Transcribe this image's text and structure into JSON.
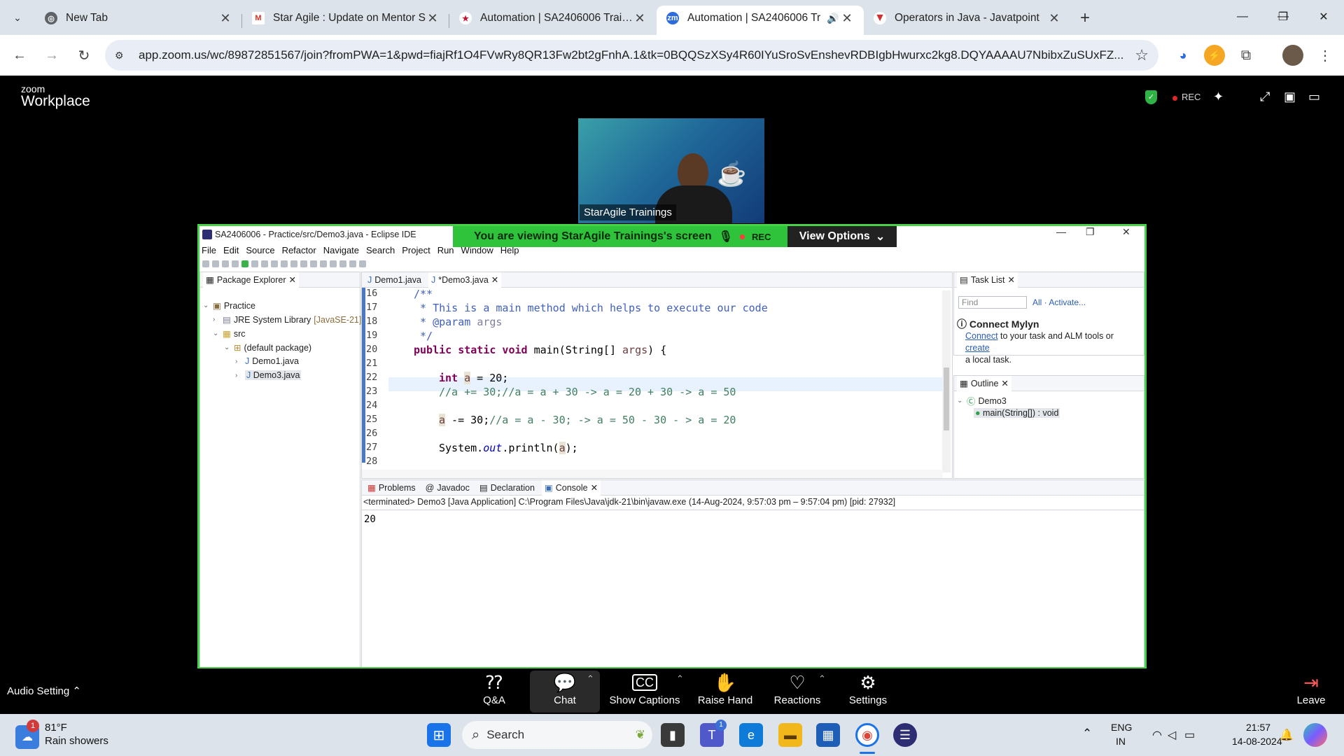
{
  "browser": {
    "tabs": [
      {
        "label": "New Tab",
        "icon": "chrome-icon"
      },
      {
        "label": "Star Agile : Update on Mentor S",
        "icon": "gmail-icon"
      },
      {
        "label": "Automation | SA2406006 Trainin",
        "icon": "staragile-icon"
      },
      {
        "label": "Automation | SA2406006 Tr",
        "icon": "zoom-icon"
      },
      {
        "label": "Operators in Java - Javatpoint",
        "icon": "javatpoint-icon"
      }
    ],
    "url": "app.zoom.us/wc/89872851567/join?fromPWA=1&pwd=fiajRf1O4FVwRy8QR13Fw2bt2gFnhA.1&tk=0BQQSzXSy4R60IYuSroSvEnshevRDBIgbHwurxc2kg8.DQYAAAAU7NbibxZuSUxFZ..."
  },
  "zoom": {
    "logo_top": "zoom",
    "logo_bottom": "Workplace",
    "rec_label": "REC",
    "speaker_name": "StarAgile Trainings",
    "banner_text": "You are viewing  StarAgile Trainings's screen",
    "banner_rec": "REC",
    "view_options": "View Options",
    "audio_setting": "Audio Setting",
    "toolbar": [
      {
        "label": "Q&A",
        "icon": "qa-icon"
      },
      {
        "label": "Chat",
        "icon": "chat-icon"
      },
      {
        "label": "Show Captions",
        "icon": "cc-icon"
      },
      {
        "label": "Raise Hand",
        "icon": "hand-icon"
      },
      {
        "label": "Reactions",
        "icon": "heart-icon"
      },
      {
        "label": "Settings",
        "icon": "gear-icon"
      }
    ],
    "leave": "Leave"
  },
  "eclipse": {
    "title": "SA2406006 - Practice/src/Demo3.java - Eclipse IDE",
    "menu": [
      "File",
      "Edit",
      "Source",
      "Refactor",
      "Navigate",
      "Search",
      "Project",
      "Run",
      "Window",
      "Help"
    ],
    "package_explorer": "Package Explorer",
    "tree": {
      "project": "Practice",
      "jre": "JRE System Library",
      "jre_version": "[JavaSE-21]",
      "src": "src",
      "pkg": "(default package)",
      "file1": "Demo1.java",
      "file2": "Demo3.java"
    },
    "editor_tabs": [
      "Demo1.java",
      "*Demo3.java"
    ],
    "line_numbers": [
      "16",
      "17",
      "18",
      "19",
      "20",
      "21",
      "22",
      "23",
      "24",
      "25",
      "26",
      "27",
      "28"
    ],
    "code": {
      "l17": "/**",
      "l18": " * This is a main method which helps to execute our code",
      "l19_a": " * @param ",
      "l19_b": "args",
      "l20": " */",
      "l21_kw": "public static void",
      "l21_rest": " main(String[] ",
      "l21_var": "args",
      "l21_end": ") {",
      "l23_kw": "int",
      "l23_var": "a",
      "l23_rest": " = 20;",
      "l24_cm": "//a += 30;//a = a + 30 -> a = 20 + 30 -> a = 50",
      "l26_var": "a",
      "l26_rest": " -= 30;",
      "l26_cm": "//a = a - 30; -> a = 50 - 30 - > a = 20",
      "l28_a": "System.",
      "l28_fld": "out",
      "l28_b": ".println(",
      "l28_var": "a",
      "l28_c": ");"
    },
    "task_list": "Task List",
    "find_placeholder": "Find",
    "all": "All",
    "activate": "Activate...",
    "mylyn_title": "Connect Mylyn",
    "mylyn_connect": "Connect",
    "mylyn_text1": " to your task and ALM tools or ",
    "mylyn_create": "create",
    "mylyn_text2": "a local task.",
    "outline": "Outline",
    "outline_class": "Demo3",
    "outline_method": "main(String[]) : void",
    "bottom_tabs": [
      "Problems",
      "Javadoc",
      "Declaration",
      "Console"
    ],
    "console_status": "<terminated> Demo3 [Java Application] C:\\Program Files\\Java\\jdk-21\\bin\\javaw.exe  (14-Aug-2024, 9:57:03 pm – 9:57:04 pm) [pid: 27932]",
    "console_output": "20"
  },
  "taskbar": {
    "weather_temp": "81°F",
    "weather_desc": "Rain showers",
    "weather_badge": "1",
    "search": "Search",
    "teams_badge": "1",
    "lang1": "ENG",
    "lang2": "IN",
    "time": "21:57",
    "date": "14-08-2024"
  }
}
